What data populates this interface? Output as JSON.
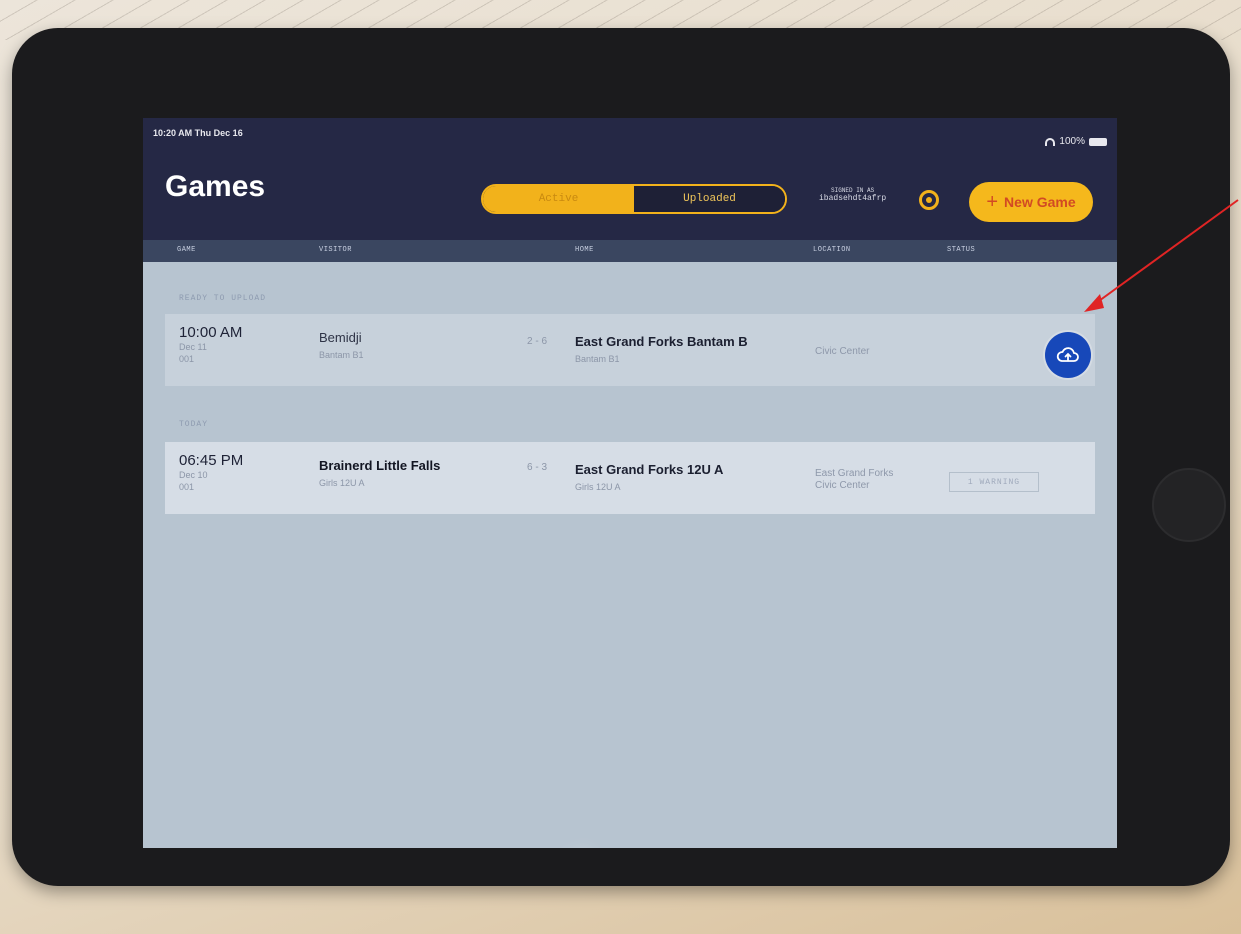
{
  "status_bar": {
    "time": "10:20 AM  Thu Dec 16",
    "battery": "100%"
  },
  "header": {
    "title": "Games",
    "tabs": [
      "Active",
      "Uploaded"
    ],
    "signed_in_label": "SIGNED IN AS",
    "signed_in_user": "ibadsehdt4afrp",
    "new_game_label": "New Game"
  },
  "columns": [
    "GAME",
    "VISITOR",
    "HOME",
    "LOCATION",
    "STATUS"
  ],
  "sections": [
    {
      "label": "READY TO UPLOAD",
      "game": {
        "time": "10:00 AM",
        "date": "Dec 11",
        "number": "001",
        "visitor": "Bemidji",
        "visitor_sub": "Bantam B1",
        "score": "2 - 6",
        "home": "East Grand Forks Bantam B",
        "home_sub": "Bantam B1",
        "location_line1": "Civic Center",
        "location_line2": "",
        "status": ""
      }
    },
    {
      "label": "TODAY",
      "game": {
        "time": "06:45 PM",
        "date": "Dec 10",
        "number": "001",
        "visitor": "Brainerd Little Falls",
        "visitor_sub": "Girls 12U A",
        "score": "6 - 3",
        "home": "East Grand Forks 12U A",
        "home_sub": "Girls 12U A",
        "location_line1": "East Grand Forks",
        "location_line2": "Civic Center",
        "status": "1 WARNING"
      }
    }
  ],
  "colors": {
    "accent": "#f2b21b",
    "nav": "#252845",
    "upload": "#1748b9",
    "annotation": "#e02424"
  },
  "icons": {
    "upload": "cloud-upload-icon",
    "settings": "gear-icon",
    "add": "plus-icon"
  }
}
